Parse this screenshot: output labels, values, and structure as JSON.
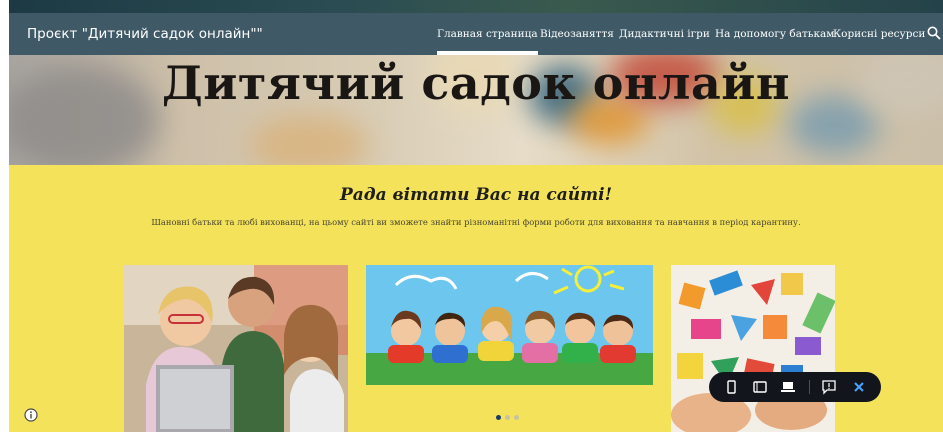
{
  "header": {
    "site_title": "Проєкт \"Дитячий садок онлайн\"\"",
    "nav": [
      {
        "label": "Главная страница",
        "active": true
      },
      {
        "label": "Відеозаняття",
        "active": false
      },
      {
        "label": "Дидактичні ігри",
        "active": false
      },
      {
        "label": "На допомогу батькам",
        "active": false
      },
      {
        "label": "Корисні ресурси",
        "active": false
      }
    ],
    "search_icon": "search-icon"
  },
  "hero": {
    "title": "Дитячий садок онлайн"
  },
  "intro": {
    "heading": "Рада вітати Вас на сайті!",
    "text": "Шановні батьки та любі вихованці, на цьому сайті ви зможете знайти різноманітні форми роботи для виховання та навчання в період карантину."
  },
  "carousel": {
    "slide_count": 3,
    "active_index": 0
  },
  "toolbar": {
    "icons": [
      "mobile-view-icon",
      "tablet-view-icon",
      "laptop-view-icon",
      "feedback-icon",
      "close-icon"
    ]
  },
  "colors": {
    "navbar": "#3f5a66",
    "section_bg": "#f3e25a",
    "toolbar_bg": "#12161c",
    "close_accent": "#4aa3ff"
  }
}
